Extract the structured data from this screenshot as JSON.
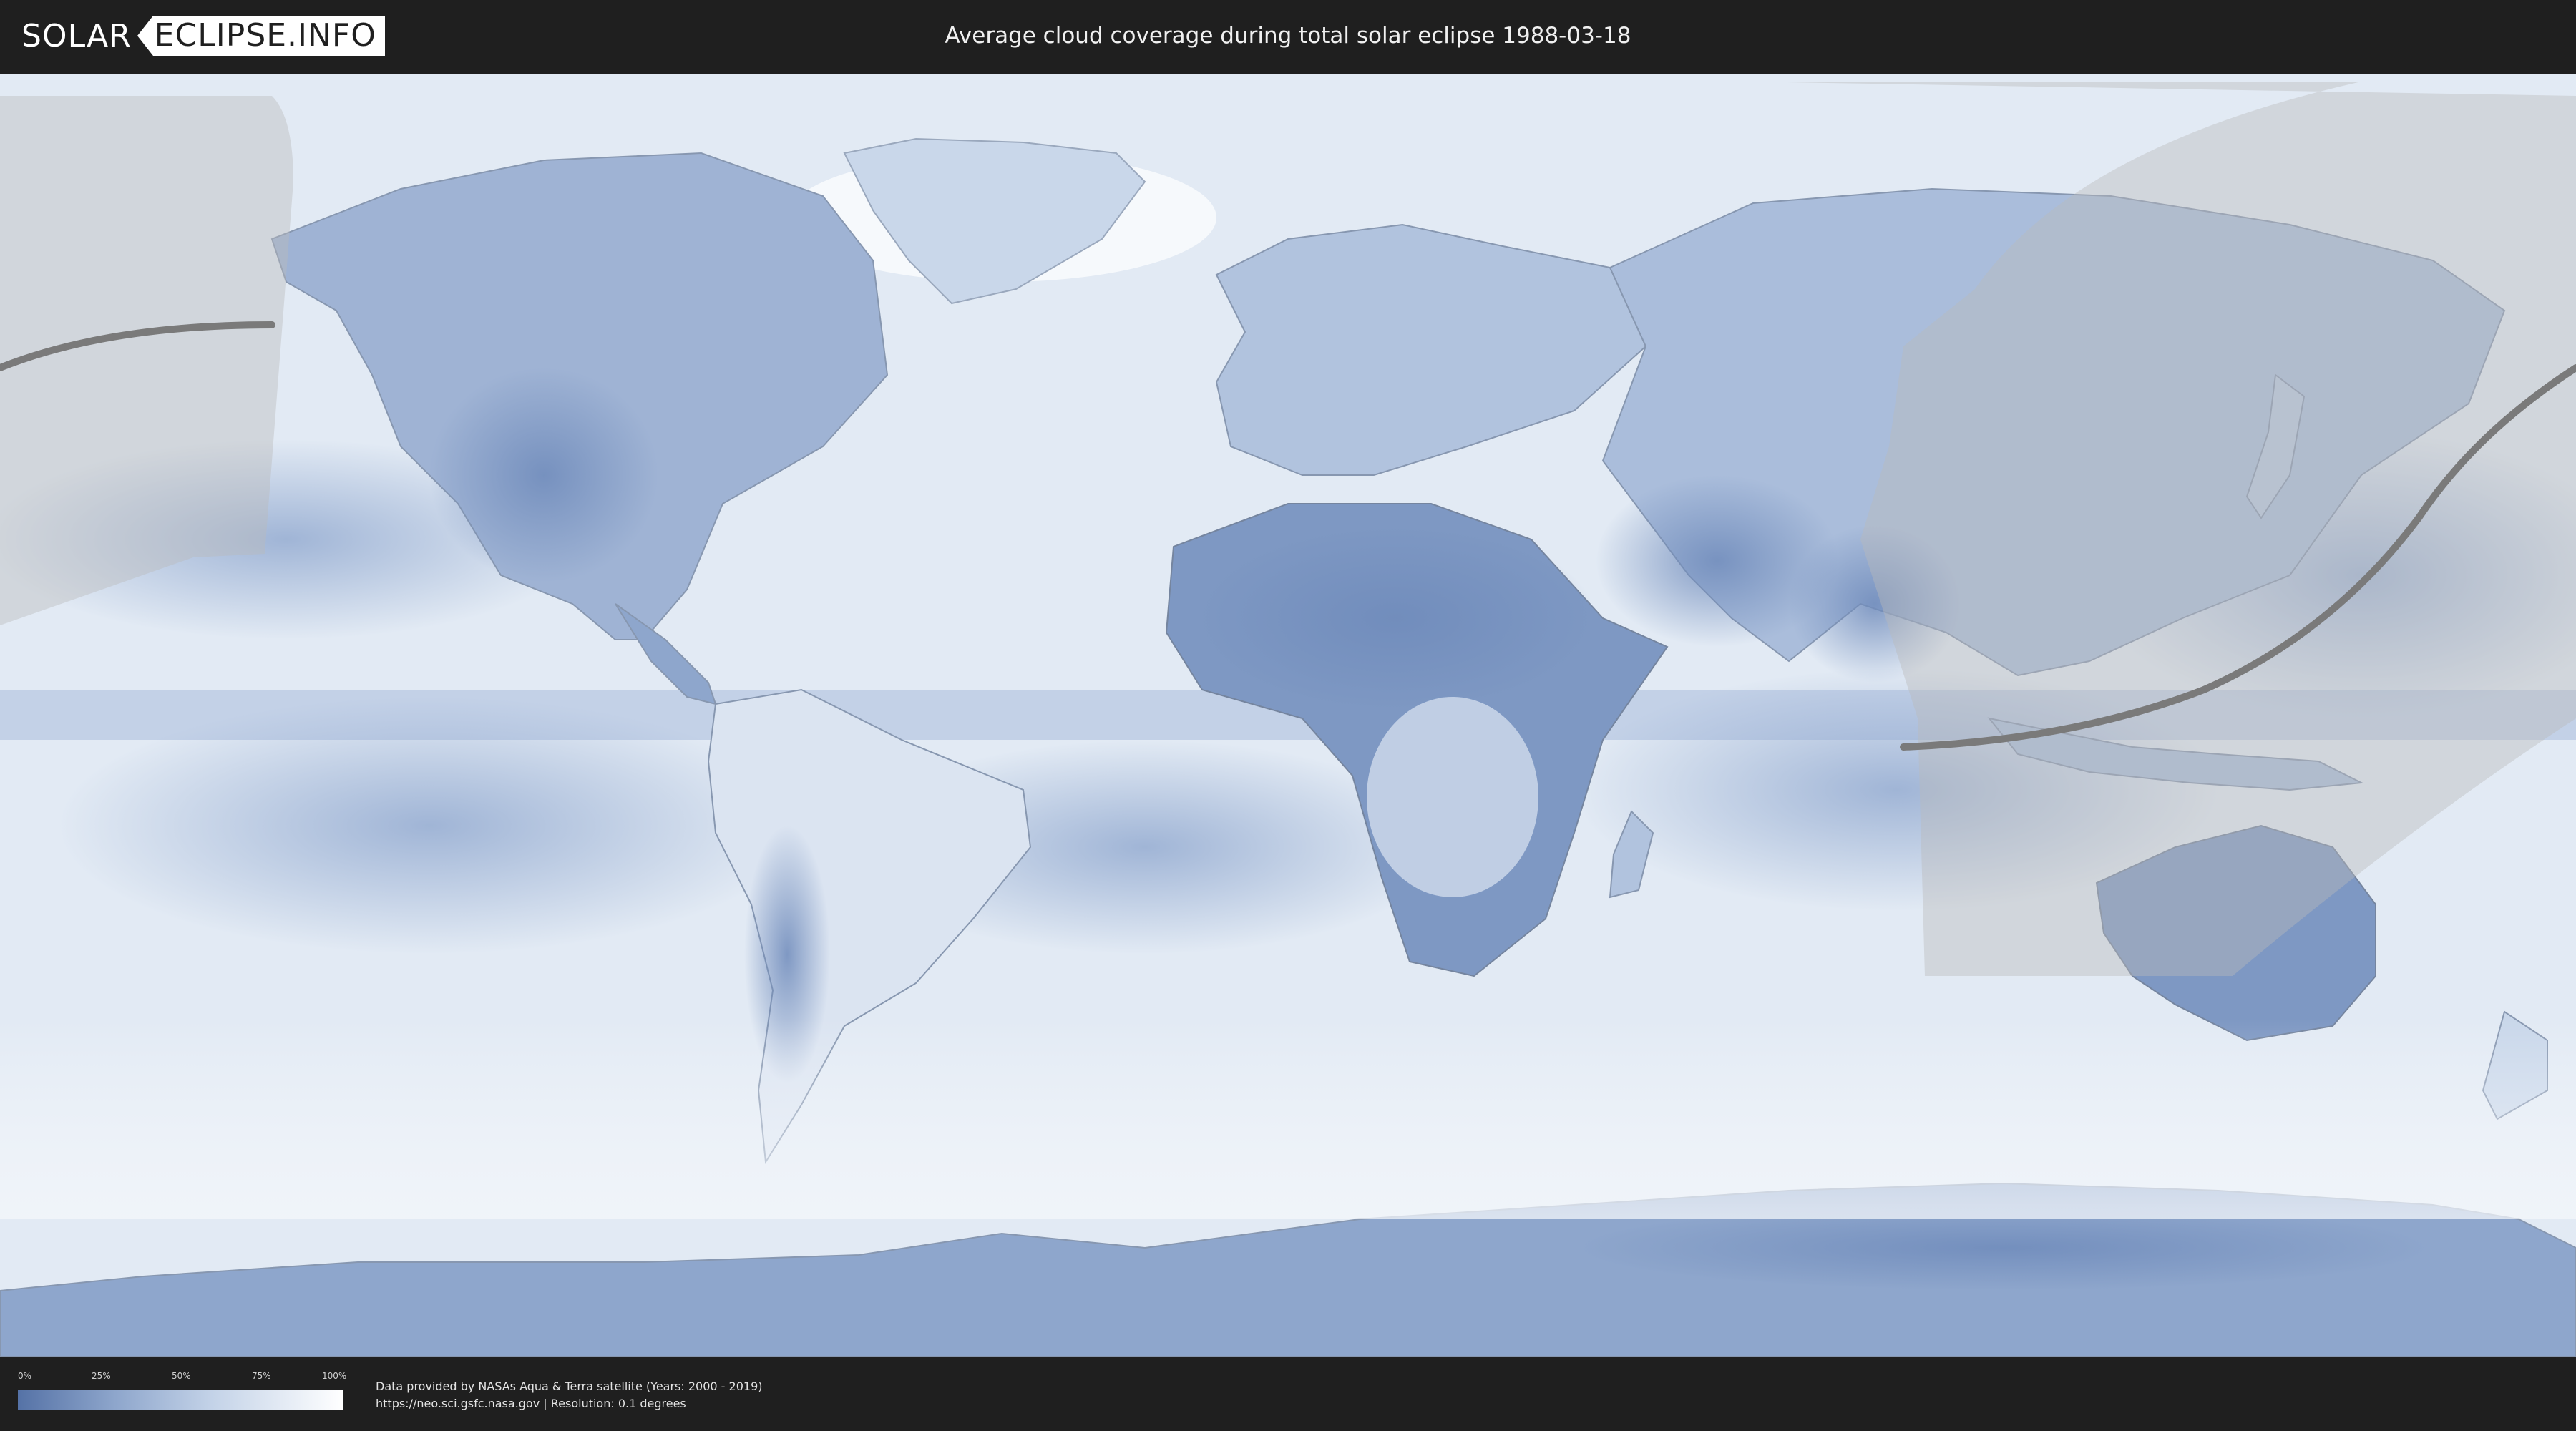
{
  "header": {
    "logo_left": "SOLAR",
    "logo_right": "ECLIPSE.INFO",
    "title": "Average cloud coverage during total solar eclipse 1988-03-18"
  },
  "legend": {
    "ticks": [
      "0%",
      "25%",
      "50%",
      "75%",
      "100%"
    ],
    "colors": {
      "low": "#5572a6",
      "mid": "#c4d3e8",
      "high": "#ffffff"
    }
  },
  "credits": {
    "line1": "Data provided by NASAs Aqua & Terra satellite (Years: 2000 - 2019)",
    "line2": "https://neo.sci.gsfc.nasa.gov | Resolution: 0.1 degrees"
  },
  "map": {
    "ocean_color": "#e2eaf4",
    "land_color": "#7e98c3",
    "eclipse_zone_color": "#a8a8a8",
    "eclipse_path_color": "#7a7a7a"
  }
}
